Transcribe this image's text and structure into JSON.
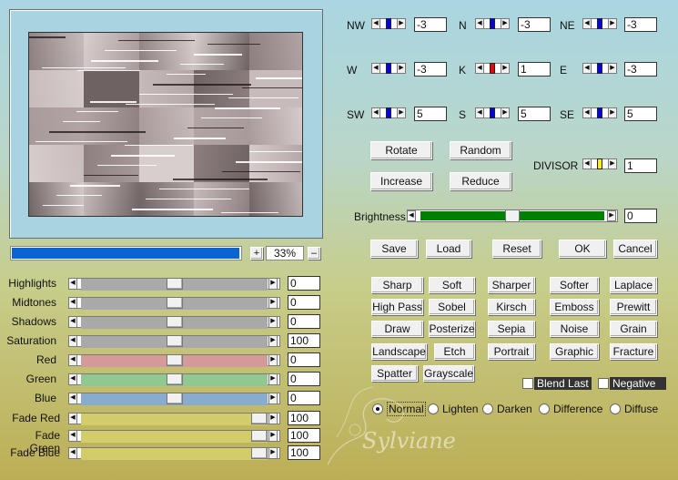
{
  "matrix": [
    {
      "id": "nw",
      "label": "NW",
      "value": "-3",
      "color": "#0000ee"
    },
    {
      "id": "n",
      "label": "N",
      "value": "-3",
      "color": "#0000ee"
    },
    {
      "id": "ne",
      "label": "NE",
      "value": "-3",
      "color": "#0000ee"
    },
    {
      "id": "w",
      "label": "W",
      "value": "-3",
      "color": "#0000ee"
    },
    {
      "id": "k",
      "label": "K",
      "value": "1",
      "color": "#ee0000"
    },
    {
      "id": "e",
      "label": "E",
      "value": "-3",
      "color": "#0000ee"
    },
    {
      "id": "sw",
      "label": "SW",
      "value": "5",
      "color": "#0000ee"
    },
    {
      "id": "s",
      "label": "S",
      "value": "5",
      "color": "#0000ee"
    },
    {
      "id": "se",
      "label": "SE",
      "value": "5",
      "color": "#0000ee"
    }
  ],
  "divisor": {
    "label": "DIVISOR",
    "value": "1",
    "color": "#ffee00"
  },
  "matrix_buttons": {
    "rotate": "Rotate",
    "random": "Random",
    "increase": "Increase",
    "reduce": "Reduce"
  },
  "brightness": {
    "label": "Brightness",
    "value": "0",
    "level": 0.5,
    "color": "#008000"
  },
  "actions": {
    "save": "Save",
    "load": "Load",
    "reset": "Reset",
    "ok": "OK",
    "cancel": "Cancel"
  },
  "zoom": {
    "value": "33%",
    "plus": "+",
    "minus": "–",
    "progress_color": "#0a64d2"
  },
  "sliders": [
    {
      "id": "highlights",
      "label": "Highlights",
      "value": "0",
      "level": 0.5,
      "color": "#a9a9a9"
    },
    {
      "id": "midtones",
      "label": "Midtones",
      "value": "0",
      "level": 0.5,
      "color": "#a9a9a9"
    },
    {
      "id": "shadows",
      "label": "Shadows",
      "value": "0",
      "level": 0.5,
      "color": "#a9a9a9"
    },
    {
      "id": "saturation",
      "label": "Saturation",
      "value": "100",
      "level": 0.5,
      "color": "#a9a9a9"
    },
    {
      "id": "red",
      "label": "Red",
      "value": "0",
      "level": 0.5,
      "color": "#d49a9a"
    },
    {
      "id": "green",
      "label": "Green",
      "value": "0",
      "level": 0.5,
      "color": "#90c890"
    },
    {
      "id": "blue",
      "label": "Blue",
      "value": "0",
      "level": 0.5,
      "color": "#88acd0"
    },
    {
      "id": "fade-red",
      "label": "Fade Red",
      "value": "100",
      "level": 1.0,
      "color": "#d2cd6a"
    },
    {
      "id": "fade-green",
      "label": "Fade Green",
      "value": "100",
      "level": 1.0,
      "color": "#d2cd6a"
    },
    {
      "id": "fade-blue",
      "label": "Fade Blue",
      "value": "100",
      "level": 1.0,
      "color": "#d2cd6a"
    }
  ],
  "presets": [
    {
      "id": "sharp",
      "label": "Sharp"
    },
    {
      "id": "soft",
      "label": "Soft"
    },
    {
      "id": "sharper",
      "label": "Sharper"
    },
    {
      "id": "softer",
      "label": "Softer"
    },
    {
      "id": "laplace",
      "label": "Laplace"
    },
    {
      "id": "high-pass",
      "label": "High Pass"
    },
    {
      "id": "sobel",
      "label": "Sobel"
    },
    {
      "id": "kirsch",
      "label": "Kirsch"
    },
    {
      "id": "emboss",
      "label": "Emboss"
    },
    {
      "id": "prewitt",
      "label": "Prewitt"
    },
    {
      "id": "draw",
      "label": "Draw"
    },
    {
      "id": "posterize",
      "label": "Posterize"
    },
    {
      "id": "sepia",
      "label": "Sepia"
    },
    {
      "id": "noise",
      "label": "Noise"
    },
    {
      "id": "grain",
      "label": "Grain"
    },
    {
      "id": "landscape",
      "label": "Landscape"
    },
    {
      "id": "etch",
      "label": "Etch"
    },
    {
      "id": "portrait",
      "label": "Portrait"
    },
    {
      "id": "graphic",
      "label": "Graphic"
    },
    {
      "id": "fracture",
      "label": "Fracture"
    },
    {
      "id": "spatter",
      "label": "Spatter"
    },
    {
      "id": "grayscale",
      "label": "Grayscale"
    }
  ],
  "checkboxes": {
    "blend_last": "Blend Last",
    "negative": "Negative"
  },
  "blend_modes": [
    {
      "id": "normal",
      "label": "Normal",
      "selected": true
    },
    {
      "id": "lighten",
      "label": "Lighten",
      "selected": false
    },
    {
      "id": "darken",
      "label": "Darken",
      "selected": false
    },
    {
      "id": "difference",
      "label": "Difference",
      "selected": false
    },
    {
      "id": "diffuse",
      "label": "Diffuse",
      "selected": false
    }
  ],
  "watermark": "Sylviane"
}
